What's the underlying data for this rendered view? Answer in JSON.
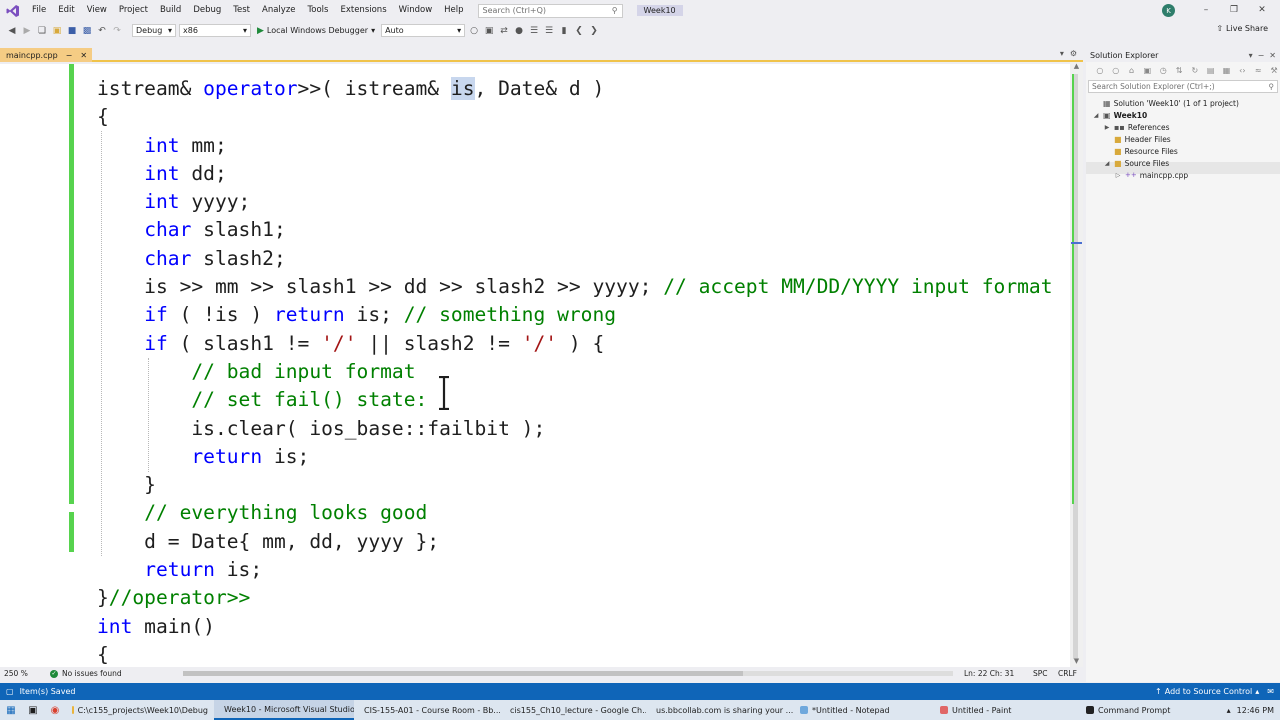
{
  "menu": {
    "items": [
      "File",
      "Edit",
      "View",
      "Project",
      "Build",
      "Debug",
      "Test",
      "Analyze",
      "Tools",
      "Extensions",
      "Window",
      "Help"
    ],
    "search_placeholder": "Search (Ctrl+Q)",
    "solution_name": "Week10",
    "avatar_initial": "K"
  },
  "toolbar": {
    "config": "Debug",
    "platform": "x86",
    "debugger": "Local Windows Debugger",
    "mode": "Auto",
    "live_share": "Live Share"
  },
  "editor": {
    "tab_name": "maincpp.cpp",
    "lines": [
      [
        [
          "istream& ",
          "p"
        ],
        [
          "operator",
          "k"
        ],
        [
          ">>( istream& ",
          "p"
        ],
        [
          "is",
          "h"
        ],
        [
          ", Date& d )",
          "p"
        ]
      ],
      [
        [
          "{",
          "p"
        ]
      ],
      [
        [
          "    ",
          "p"
        ],
        [
          "int",
          "k"
        ],
        [
          " mm;",
          "p"
        ]
      ],
      [
        [
          "    ",
          "p"
        ],
        [
          "int",
          "k"
        ],
        [
          " dd;",
          "p"
        ]
      ],
      [
        [
          "    ",
          "p"
        ],
        [
          "int",
          "k"
        ],
        [
          " yyyy;",
          "p"
        ]
      ],
      [
        [
          "    ",
          "p"
        ],
        [
          "char",
          "k"
        ],
        [
          " slash1;",
          "p"
        ]
      ],
      [
        [
          "    ",
          "p"
        ],
        [
          "char",
          "k"
        ],
        [
          " slash2;",
          "p"
        ]
      ],
      [
        [
          "    is >> mm >> slash1 >> dd >> slash2 >> yyyy; ",
          "p"
        ],
        [
          "// accept MM/DD/YYYY input format",
          "c"
        ]
      ],
      [
        [
          "    ",
          "p"
        ],
        [
          "if",
          "k"
        ],
        [
          " ( !is ) ",
          "p"
        ],
        [
          "return",
          "k"
        ],
        [
          " is; ",
          "p"
        ],
        [
          "// something wrong",
          "c"
        ]
      ],
      [
        [
          "    ",
          "p"
        ],
        [
          "if",
          "k"
        ],
        [
          " ( slash1 != ",
          "p"
        ],
        [
          "'/'",
          "s"
        ],
        [
          " || slash2 != ",
          "p"
        ],
        [
          "'/'",
          "s"
        ],
        [
          " ) {",
          "p"
        ]
      ],
      [
        [
          "        ",
          "p"
        ],
        [
          "// bad input format",
          "c"
        ]
      ],
      [
        [
          "        ",
          "p"
        ],
        [
          "// set fail() state:",
          "c"
        ]
      ],
      [
        [
          "        is.clear( ios_base::failbit );",
          "p"
        ]
      ],
      [
        [
          "        ",
          "p"
        ],
        [
          "return",
          "k"
        ],
        [
          " is;",
          "p"
        ]
      ],
      [
        [
          "    }",
          "p"
        ]
      ],
      [
        [
          "    ",
          "p"
        ],
        [
          "// everything looks good",
          "c"
        ]
      ],
      [
        [
          "    d = Date{ mm, dd, yyyy };",
          "p"
        ]
      ],
      [
        [
          "    ",
          "p"
        ],
        [
          "return",
          "k"
        ],
        [
          " is;",
          "p"
        ]
      ],
      [
        [
          "}",
          "p"
        ],
        [
          "//operator>>",
          "c"
        ]
      ],
      [
        [
          "int",
          "k"
        ],
        [
          " main()",
          "p"
        ]
      ],
      [
        [
          "{",
          "p"
        ]
      ]
    ]
  },
  "editor_status": {
    "zoom": "250 %",
    "issues": "No issues found",
    "position": "Ln: 22    Ch: 31",
    "whitespace": "SPC",
    "line_ending": "CRLF"
  },
  "solution_explorer": {
    "title": "Solution Explorer",
    "search_placeholder": "Search Solution Explorer (Ctrl+;)",
    "solution": "Solution 'Week10' (1 of 1 project)",
    "project": "Week10",
    "references": "References",
    "header_files": "Header Files",
    "resource_files": "Resource Files",
    "source_files": "Source Files",
    "file": "maincpp.cpp"
  },
  "statusbar": {
    "left": "Item(s) Saved",
    "right": "Add to Source Control"
  },
  "taskbar": {
    "items": [
      "C:\\c155_projects\\Week10\\Debug",
      "Week10 - Microsoft Visual Studio",
      "CIS-155-A01 - Course Room - Bb...",
      "cis155_Ch10_lecture - Google Ch...",
      "us.bbcollab.com is sharing your ...",
      "*Untitled - Notepad",
      "Untitled - Paint",
      "Command Prompt"
    ],
    "time": "12:46 PM"
  },
  "colors": {
    "keyword": "#0000ff",
    "comment": "#008000",
    "string": "#a31515",
    "change_bar": "#57d34e",
    "status_bar": "#0f65b8"
  }
}
